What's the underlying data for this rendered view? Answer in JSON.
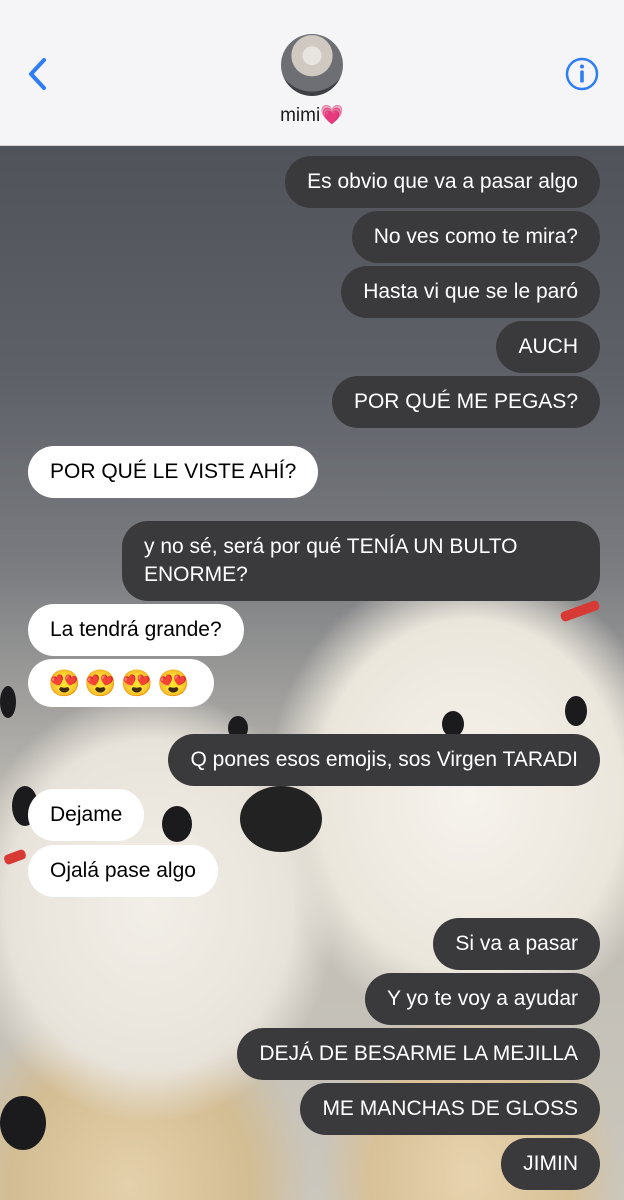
{
  "header": {
    "contact_name": "mimi💗",
    "back_icon": "chevron-left-icon",
    "info_icon": "info-circle-icon",
    "accent": "#2c7df6"
  },
  "messages": [
    {
      "from": "me",
      "text": "Es obvio que va a pasar algo"
    },
    {
      "from": "me",
      "text": "No ves como te mira?"
    },
    {
      "from": "me",
      "text": "Hasta vi que se le paró"
    },
    {
      "from": "me",
      "text": "AUCH"
    },
    {
      "from": "me",
      "text": "POR QUÉ ME PEGAS?"
    },
    {
      "from": "them",
      "text": "POR QUÉ LE VISTE AHÍ?"
    },
    {
      "from": "me",
      "text": "y no sé, será por qué TENÍA UN BULTO ENORME?"
    },
    {
      "from": "them",
      "text": "La tendrá grande?"
    },
    {
      "from": "them",
      "text": "😍😍😍😍"
    },
    {
      "from": "me",
      "text": "Q pones esos emojis, sos Virgen TARADI"
    },
    {
      "from": "them",
      "text": "Dejame"
    },
    {
      "from": "them",
      "text": "Ojalá pase algo"
    },
    {
      "from": "me",
      "text": "Si va a pasar"
    },
    {
      "from": "me",
      "text": "Y yo te voy a ayudar"
    },
    {
      "from": "me",
      "text": "DEJÁ DE BESARME LA MEJILLA"
    },
    {
      "from": "me",
      "text": "ME MANCHAS DE GLOSS"
    },
    {
      "from": "me",
      "text": "JIMIN"
    }
  ],
  "colors": {
    "sent_bubble": "#3a3a3c",
    "received_bubble": "#ffffff"
  }
}
